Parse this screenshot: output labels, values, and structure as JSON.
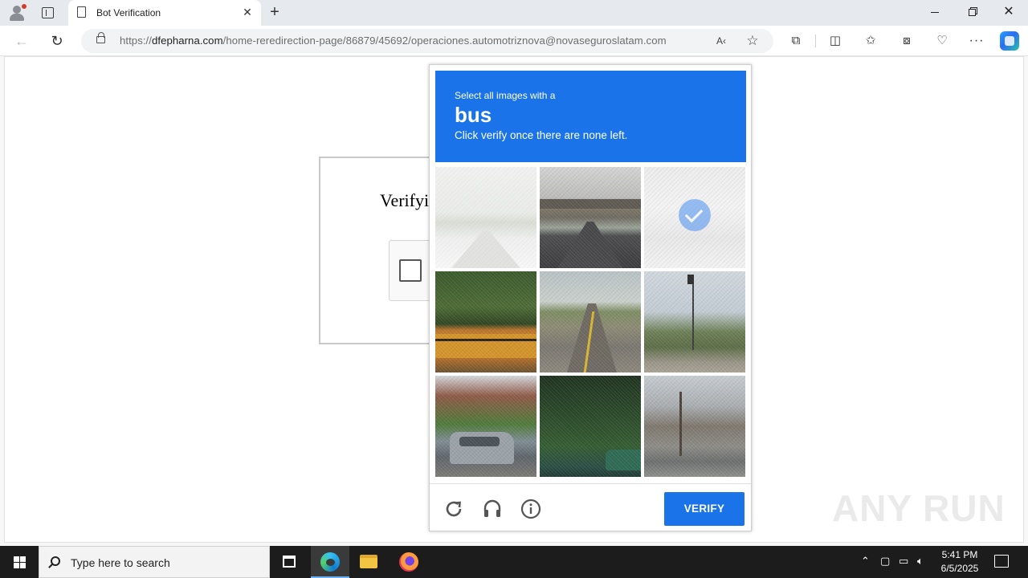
{
  "browser": {
    "tab_title": "Bot Verification",
    "url_scheme": "https://",
    "url_host": "dfepharna.com",
    "url_path": "/home-reredirection-page/86879/45692/operaciones.automotriznova@novaseguroslatam.com"
  },
  "page": {
    "verify_title": "Verifyi"
  },
  "challenge": {
    "instruction_line1": "Select all images with a",
    "target_object": "bus",
    "instruction_line3": "Click verify once there are none left.",
    "tiles": [
      {
        "state": "faded"
      },
      {
        "state": "normal"
      },
      {
        "state": "selected"
      },
      {
        "state": "normal"
      },
      {
        "state": "normal"
      },
      {
        "state": "normal"
      },
      {
        "state": "normal"
      },
      {
        "state": "normal"
      },
      {
        "state": "normal"
      }
    ],
    "verify_label": "VERIFY",
    "accent_color": "#1a73e8"
  },
  "watermark": "ANY RUN",
  "taskbar": {
    "search_placeholder": "Type here to search",
    "time": "5:41 PM",
    "date": "6/5/2025"
  }
}
